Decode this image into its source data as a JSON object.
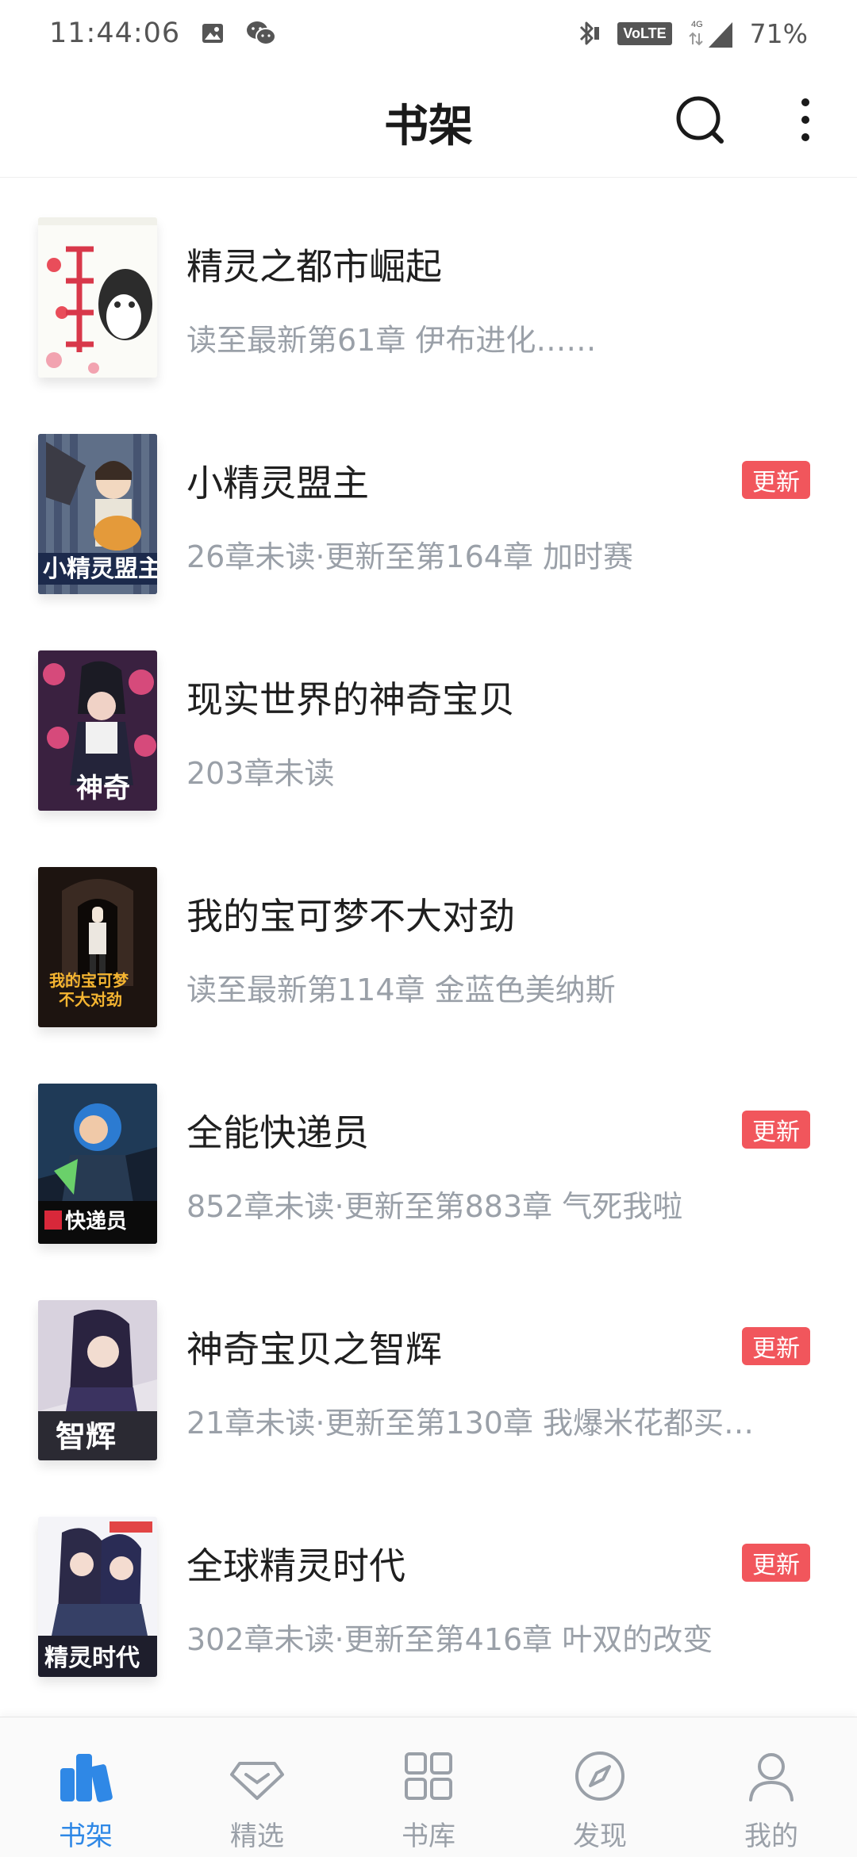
{
  "status_bar": {
    "time": "11:44:06",
    "volte": "VoLTE",
    "network": "4G",
    "battery": "71%",
    "icons": [
      "image-icon",
      "wechat-icon",
      "bluetooth-icon",
      "signal-icon"
    ]
  },
  "header": {
    "title": "书架",
    "icons": [
      "search-icon",
      "more-icon"
    ]
  },
  "books": [
    {
      "title": "精灵之都市崛起",
      "subtitle": "读至最新第61章 伊布进化……",
      "badge": ""
    },
    {
      "title": "小精灵盟主",
      "subtitle": "26章未读·更新至第164章 加时赛",
      "badge": "更新"
    },
    {
      "title": "现实世界的神奇宝贝",
      "subtitle": "203章未读",
      "badge": ""
    },
    {
      "title": "我的宝可梦不大对劲",
      "subtitle": "读至最新第114章 金蓝色美纳斯",
      "badge": ""
    },
    {
      "title": "全能快递员",
      "subtitle": "852章未读·更新至第883章 气死我啦",
      "badge": "更新"
    },
    {
      "title": "神奇宝贝之智辉",
      "subtitle": "21章未读·更新至第130章 我爆米花都买…",
      "badge": "更新"
    },
    {
      "title": "全球精灵时代",
      "subtitle": "302章未读·更新至第416章 叶双的改变",
      "badge": "更新"
    }
  ],
  "bottom_nav": [
    {
      "label": "书架",
      "icon": "bookshelf-icon",
      "active": true
    },
    {
      "label": "精选",
      "icon": "diamond-icon",
      "active": false
    },
    {
      "label": "书库",
      "icon": "grid-icon",
      "active": false
    },
    {
      "label": "发现",
      "icon": "compass-icon",
      "active": false
    },
    {
      "label": "我的",
      "icon": "profile-icon",
      "active": false
    }
  ],
  "colors": {
    "accent": "#2f88e6",
    "badge": "#f1565c",
    "subtitle": "#9aa0a8"
  }
}
